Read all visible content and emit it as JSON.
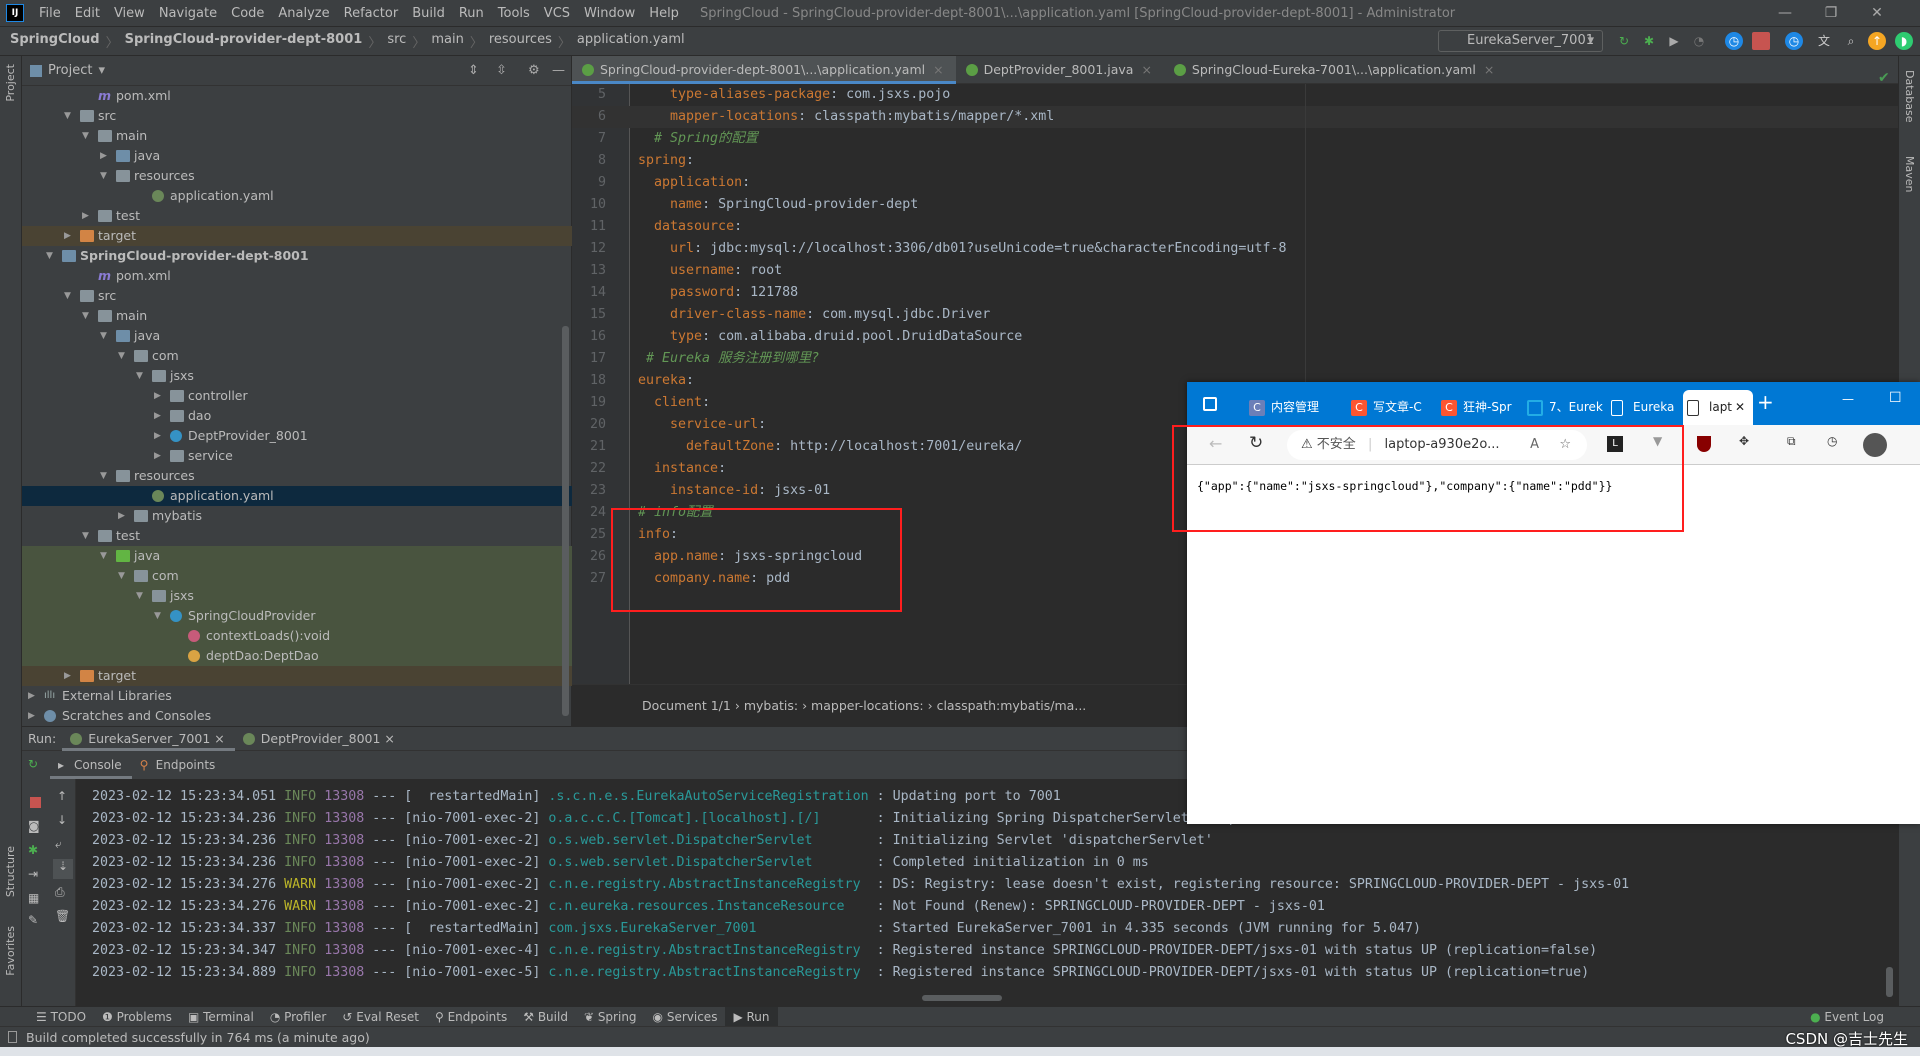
{
  "titlebar": {
    "menu": [
      "File",
      "Edit",
      "View",
      "Navigate",
      "Code",
      "Analyze",
      "Refactor",
      "Build",
      "Run",
      "Tools",
      "VCS",
      "Window",
      "Help"
    ],
    "title": "SpringCloud - SpringCloud-provider-dept-8001\\...\\application.yaml [SpringCloud-provider-dept-8001] - Administrator",
    "logo": "IJ"
  },
  "breadcrumb": [
    "SpringCloud",
    "SpringCloud-provider-dept-8001",
    "src",
    "main",
    "resources",
    "application.yaml"
  ],
  "run_config": "EurekaServer_7001",
  "left_strip": [
    "Project",
    "Structure",
    "Favorites"
  ],
  "right_strip": [
    "Database",
    "Maven"
  ],
  "project": {
    "title": "Project",
    "tree": [
      {
        "label": "pom.xml",
        "depth": 3,
        "icon": "maven",
        "arrow": ""
      },
      {
        "label": "src",
        "depth": 2,
        "icon": "folder",
        "arrow": "down"
      },
      {
        "label": "main",
        "depth": 3,
        "icon": "folder",
        "arrow": "down"
      },
      {
        "label": "java",
        "depth": 4,
        "icon": "folder-blue",
        "arrow": "right"
      },
      {
        "label": "resources",
        "depth": 4,
        "icon": "folder",
        "arrow": "down"
      },
      {
        "label": "application.yaml",
        "depth": 6,
        "icon": "spring",
        "arrow": ""
      },
      {
        "label": "test",
        "depth": 3,
        "icon": "folder",
        "arrow": "right"
      },
      {
        "label": "target",
        "depth": 2,
        "icon": "folder-orange",
        "arrow": "right",
        "bg": "excluded"
      },
      {
        "label": "SpringCloud-provider-dept-8001",
        "depth": 1,
        "icon": "module",
        "arrow": "down",
        "bold": true
      },
      {
        "label": "pom.xml",
        "depth": 3,
        "icon": "maven",
        "arrow": ""
      },
      {
        "label": "src",
        "depth": 2,
        "icon": "folder",
        "arrow": "down"
      },
      {
        "label": "main",
        "depth": 3,
        "icon": "folder",
        "arrow": "down"
      },
      {
        "label": "java",
        "depth": 4,
        "icon": "folder-blue",
        "arrow": "down"
      },
      {
        "label": "com",
        "depth": 5,
        "icon": "folder",
        "arrow": "down"
      },
      {
        "label": "jsxs",
        "depth": 6,
        "icon": "folder",
        "arrow": "down"
      },
      {
        "label": "controller",
        "depth": 7,
        "icon": "folder",
        "arrow": "right"
      },
      {
        "label": "dao",
        "depth": 7,
        "icon": "folder",
        "arrow": "right"
      },
      {
        "label": "DeptProvider_8001",
        "depth": 7,
        "icon": "class",
        "arrow": "right"
      },
      {
        "label": "service",
        "depth": 7,
        "icon": "folder",
        "arrow": "right"
      },
      {
        "label": "resources",
        "depth": 4,
        "icon": "folder",
        "arrow": "down"
      },
      {
        "label": "application.yaml",
        "depth": 6,
        "icon": "spring",
        "arrow": "",
        "bg": "selected"
      },
      {
        "label": "mybatis",
        "depth": 5,
        "icon": "folder",
        "arrow": "right"
      },
      {
        "label": "test",
        "depth": 3,
        "icon": "folder",
        "arrow": "down"
      },
      {
        "label": "java",
        "depth": 4,
        "icon": "folder-green",
        "arrow": "down",
        "bg": "test"
      },
      {
        "label": "com",
        "depth": 5,
        "icon": "folder",
        "arrow": "down",
        "bg": "test"
      },
      {
        "label": "jsxs",
        "depth": 6,
        "icon": "folder",
        "arrow": "down",
        "bg": "test"
      },
      {
        "label": "SpringCloudProvider",
        "depth": 7,
        "icon": "class",
        "arrow": "down",
        "bg": "test"
      },
      {
        "label": "contextLoads():void",
        "depth": 8,
        "icon": "method",
        "arrow": "",
        "bg": "test"
      },
      {
        "label": "deptDao:DeptDao",
        "depth": 8,
        "icon": "field",
        "arrow": "",
        "bg": "test"
      },
      {
        "label": "target",
        "depth": 2,
        "icon": "folder-orange",
        "arrow": "right",
        "bg": "excluded"
      },
      {
        "label": "External Libraries",
        "depth": 0,
        "icon": "lib",
        "arrow": "right"
      },
      {
        "label": "Scratches and Consoles",
        "depth": 0,
        "icon": "scratch",
        "arrow": "right"
      }
    ]
  },
  "editor": {
    "tabs": [
      {
        "label": "SpringCloud-provider-dept-8001\\...\\application.yaml",
        "active": true
      },
      {
        "label": "DeptProvider_8001.java",
        "active": false
      },
      {
        "label": "SpringCloud-Eureka-7001\\...\\application.yaml",
        "active": false
      }
    ],
    "lines": [
      {
        "n": "5",
        "s": [
          [
            "    ",
            "v"
          ],
          [
            "type-aliases-package",
            "k"
          ],
          [
            ": com.jsxs.pojo",
            "v"
          ]
        ]
      },
      {
        "n": "6",
        "cur": true,
        "s": [
          [
            "    ",
            "v"
          ],
          [
            "mapper-locations",
            "k"
          ],
          [
            ": classpath:mybatis/mapper/*.xml",
            "v"
          ]
        ]
      },
      {
        "n": "7",
        "s": [
          [
            "  ",
            "v"
          ],
          [
            "# Spring的配置",
            "c"
          ]
        ]
      },
      {
        "n": "8",
        "s": [
          [
            "spring",
            "k"
          ],
          [
            ":",
            "v"
          ]
        ]
      },
      {
        "n": "9",
        "s": [
          [
            "  ",
            "v"
          ],
          [
            "application",
            "k"
          ],
          [
            ":",
            "v"
          ]
        ]
      },
      {
        "n": "10",
        "s": [
          [
            "    ",
            "v"
          ],
          [
            "name",
            "k"
          ],
          [
            ": SpringCloud-provider-dept",
            "v"
          ]
        ]
      },
      {
        "n": "11",
        "s": [
          [
            "  ",
            "v"
          ],
          [
            "datasource",
            "k"
          ],
          [
            ":",
            "v"
          ]
        ]
      },
      {
        "n": "12",
        "s": [
          [
            "    ",
            "v"
          ],
          [
            "url",
            "k"
          ],
          [
            ": jdbc:mysql://localhost:3306/db01?useUnicode=true&characterEncoding=utf-8",
            "v"
          ]
        ]
      },
      {
        "n": "13",
        "s": [
          [
            "    ",
            "v"
          ],
          [
            "username",
            "k"
          ],
          [
            ": root",
            "v"
          ]
        ]
      },
      {
        "n": "14",
        "s": [
          [
            "    ",
            "v"
          ],
          [
            "password",
            "k"
          ],
          [
            ": 121788",
            "v"
          ]
        ]
      },
      {
        "n": "15",
        "s": [
          [
            "    ",
            "v"
          ],
          [
            "driver-class-name",
            "k"
          ],
          [
            ": com.mysql.jdbc.Driver",
            "v"
          ]
        ]
      },
      {
        "n": "16",
        "s": [
          [
            "    ",
            "v"
          ],
          [
            "type",
            "k"
          ],
          [
            ": com.alibaba.druid.pool.DruidDataSource",
            "v"
          ]
        ]
      },
      {
        "n": "17",
        "s": [
          [
            " ",
            "v"
          ],
          [
            "# Eureka 服务注册到哪里?",
            "c"
          ]
        ]
      },
      {
        "n": "18",
        "s": [
          [
            "eureka",
            "k"
          ],
          [
            ":",
            "v"
          ]
        ]
      },
      {
        "n": "19",
        "s": [
          [
            "  ",
            "v"
          ],
          [
            "client",
            "k"
          ],
          [
            ":",
            "v"
          ]
        ]
      },
      {
        "n": "20",
        "s": [
          [
            "    ",
            "v"
          ],
          [
            "service-url",
            "k"
          ],
          [
            ":",
            "v"
          ]
        ]
      },
      {
        "n": "21",
        "s": [
          [
            "      ",
            "v"
          ],
          [
            "defaultZone",
            "k"
          ],
          [
            ": http://localhost:7001/eureka/",
            "v"
          ]
        ]
      },
      {
        "n": "22",
        "s": [
          [
            "  ",
            "v"
          ],
          [
            "instance",
            "k"
          ],
          [
            ":",
            "v"
          ]
        ]
      },
      {
        "n": "23",
        "s": [
          [
            "    ",
            "v"
          ],
          [
            "instance-id",
            "k"
          ],
          [
            ": jsxs-01",
            "v"
          ]
        ]
      },
      {
        "n": "24",
        "s": [
          [
            "# info配置",
            "c"
          ]
        ]
      },
      {
        "n": "25",
        "s": [
          [
            "info",
            "k"
          ],
          [
            ":",
            "v"
          ]
        ]
      },
      {
        "n": "26",
        "s": [
          [
            "  ",
            "v"
          ],
          [
            "app.name",
            "k"
          ],
          [
            ": jsxs-springcloud",
            "v"
          ]
        ]
      },
      {
        "n": "27",
        "s": [
          [
            "  ",
            "v"
          ],
          [
            "company.name",
            "k"
          ],
          [
            ": pdd",
            "v"
          ]
        ]
      }
    ],
    "breadcrumb": [
      "Document 1/1",
      "mybatis:",
      "mapper-locations:",
      "classpath:mybatis/ma..."
    ]
  },
  "run": {
    "label": "Run:",
    "tabs": [
      "EurekaServer_7001",
      "DeptProvider_8001"
    ],
    "subtabs": [
      "Console",
      "Endpoints"
    ],
    "logs": [
      {
        "ts": "2023-02-12 15:23:34.051",
        "lvl": "INFO",
        "pid": "13308",
        "thread": "[  restartedMain]",
        "logger": ".s.c.n.e.s.EurekaAutoServiceRegistration",
        "msg": ": Updating port to 7001"
      },
      {
        "ts": "2023-02-12 15:23:34.236",
        "lvl": "INFO",
        "pid": "13308",
        "thread": "[nio-7001-exec-2]",
        "logger": "o.a.c.c.C.[Tomcat].[localhost].[/]      ",
        "msg": ": Initializing Spring DispatcherServlet 'dispatcherServlet'"
      },
      {
        "ts": "2023-02-12 15:23:34.236",
        "lvl": "INFO",
        "pid": "13308",
        "thread": "[nio-7001-exec-2]",
        "logger": "o.s.web.servlet.DispatcherServlet       ",
        "msg": ": Initializing Servlet 'dispatcherServlet'"
      },
      {
        "ts": "2023-02-12 15:23:34.236",
        "lvl": "INFO",
        "pid": "13308",
        "thread": "[nio-7001-exec-2]",
        "logger": "o.s.web.servlet.DispatcherServlet       ",
        "msg": ": Completed initialization in 0 ms"
      },
      {
        "ts": "2023-02-12 15:23:34.276",
        "lvl": "WARN",
        "pid": "13308",
        "thread": "[nio-7001-exec-2]",
        "logger": "c.n.e.registry.AbstractInstanceRegistry ",
        "msg": ": DS: Registry: lease doesn't exist, registering resource: SPRINGCLOUD-PROVIDER-DEPT - jsxs-01"
      },
      {
        "ts": "2023-02-12 15:23:34.276",
        "lvl": "WARN",
        "pid": "13308",
        "thread": "[nio-7001-exec-2]",
        "logger": "c.n.eureka.resources.InstanceResource   ",
        "msg": ": Not Found (Renew): SPRINGCLOUD-PROVIDER-DEPT - jsxs-01"
      },
      {
        "ts": "2023-02-12 15:23:34.337",
        "lvl": "INFO",
        "pid": "13308",
        "thread": "[  restartedMain]",
        "logger": "com.jsxs.EurekaServer_7001              ",
        "msg": ": Started EurekaServer_7001 in 4.335 seconds (JVM running for 5.047)"
      },
      {
        "ts": "2023-02-12 15:23:34.347",
        "lvl": "INFO",
        "pid": "13308",
        "thread": "[nio-7001-exec-4]",
        "logger": "c.n.e.registry.AbstractInstanceRegistry ",
        "msg": ": Registered instance SPRINGCLOUD-PROVIDER-DEPT/jsxs-01 with status UP (replication=false)"
      },
      {
        "ts": "2023-02-12 15:23:34.889",
        "lvl": "INFO",
        "pid": "13308",
        "thread": "[nio-7001-exec-5]",
        "logger": "c.n.e.registry.AbstractInstanceRegistry ",
        "msg": ": Registered instance SPRINGCLOUD-PROVIDER-DEPT/jsxs-01 with status UP (replication=true)"
      }
    ]
  },
  "bottom_tools": [
    "TODO",
    "Problems",
    "Terminal",
    "Profiler",
    "Eval Reset",
    "Endpoints",
    "Build",
    "Spring",
    "Services",
    "Run"
  ],
  "event_log": "Event Log",
  "status": "Build completed successfully in 764 ms (a minute ago)",
  "browser": {
    "tabs": [
      {
        "label": "内容管理",
        "icon": "C"
      },
      {
        "label": "写文章-C",
        "icon": "C"
      },
      {
        "label": "狂神-Spr",
        "icon": "C"
      },
      {
        "label": "7、Eurek",
        "icon": "bili"
      },
      {
        "label": "Eureka",
        "icon": "page"
      },
      {
        "label": "lapt",
        "icon": "page",
        "active": true
      }
    ],
    "insecure": "不安全",
    "url": "laptop-a930e2o...",
    "content": "{\"app\":{\"name\":\"jsxs-springcloud\"},\"company\":{\"name\":\"pdd\"}}"
  },
  "watermark": "CSDN @吉士先生",
  "colors": {
    "accent": "#0078d4",
    "highlight_box": "#ff1e1e",
    "keyword": "#cc7832",
    "comment": "#629755"
  }
}
